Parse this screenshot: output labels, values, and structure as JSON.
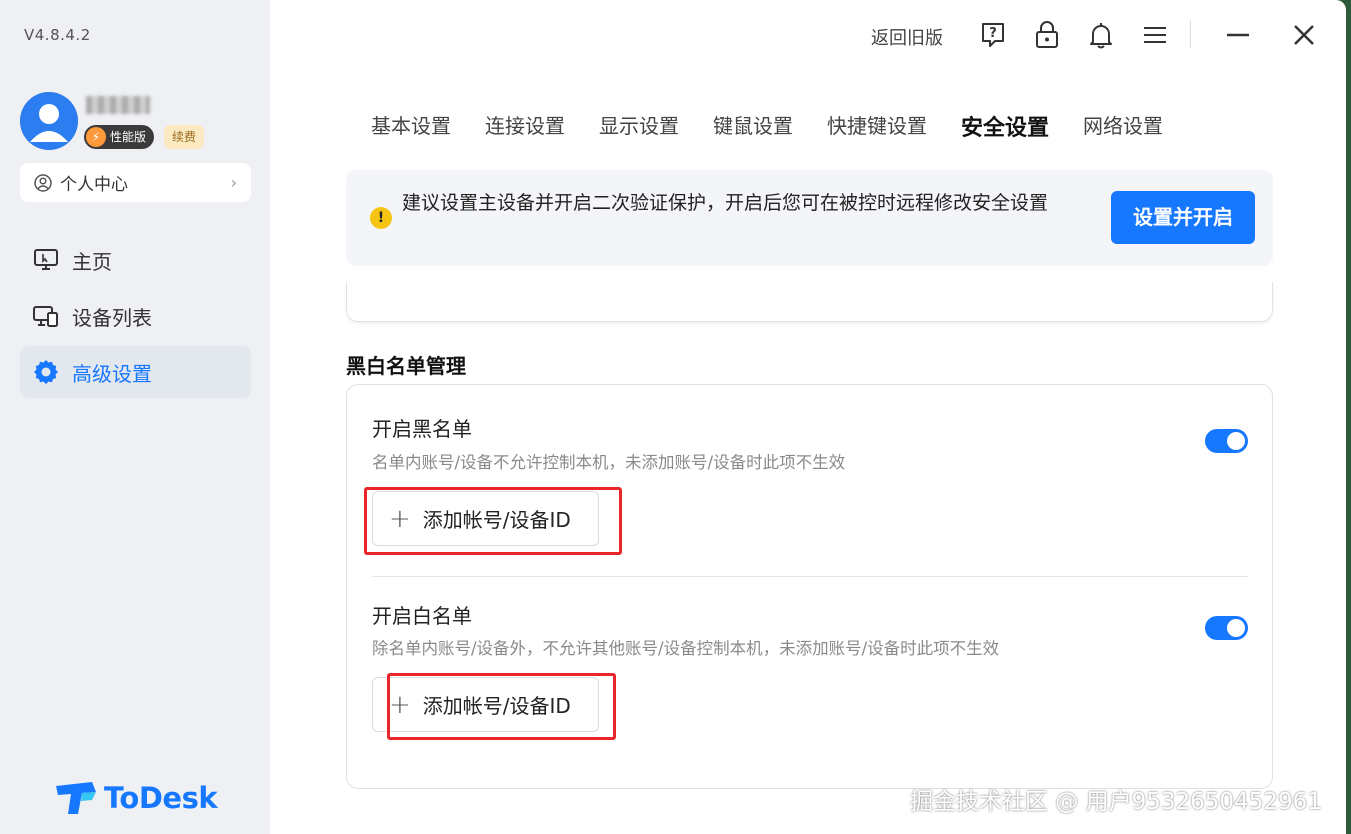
{
  "app": {
    "version": "V4.8.4.2",
    "logo_text": "ToDesk"
  },
  "user": {
    "badge_perf": "性能版",
    "badge_renew": "续费",
    "personal_center": "个人中心"
  },
  "sidebar": {
    "items": [
      {
        "label": "主页",
        "icon": "monitor-icon"
      },
      {
        "label": "设备列表",
        "icon": "devices-icon"
      },
      {
        "label": "高级设置",
        "icon": "gear-icon",
        "active": true
      }
    ]
  },
  "topbar": {
    "back_old": "返回旧版"
  },
  "tabs": [
    "基本设置",
    "连接设置",
    "显示设置",
    "键鼠设置",
    "快捷键设置",
    "安全设置",
    "网络设置"
  ],
  "active_tab": "安全设置",
  "notice": {
    "message": "建议设置主设备并开启二次验证保护，开启后您可在被控时远程修改安全设置",
    "button": "设置并开启"
  },
  "section": {
    "title": "黑白名单管理",
    "blacklist": {
      "title": "开启黑名单",
      "desc": "名单内账号/设备不允许控制本机，未添加账号/设备时此项不生效",
      "add_button": "添加帐号/设备ID",
      "enabled": true
    },
    "whitelist": {
      "title": "开启白名单",
      "desc": "除名单内账号/设备外，不允许其他账号/设备控制本机，未添加账号/设备时此项不生效",
      "add_button": "添加帐号/设备ID",
      "enabled": true
    }
  },
  "watermark": "掘金技术社区 @ 用户9532650452961",
  "colors": {
    "accent": "#1677ff",
    "highlight": "#e8262c",
    "warning": "#f6c513"
  }
}
